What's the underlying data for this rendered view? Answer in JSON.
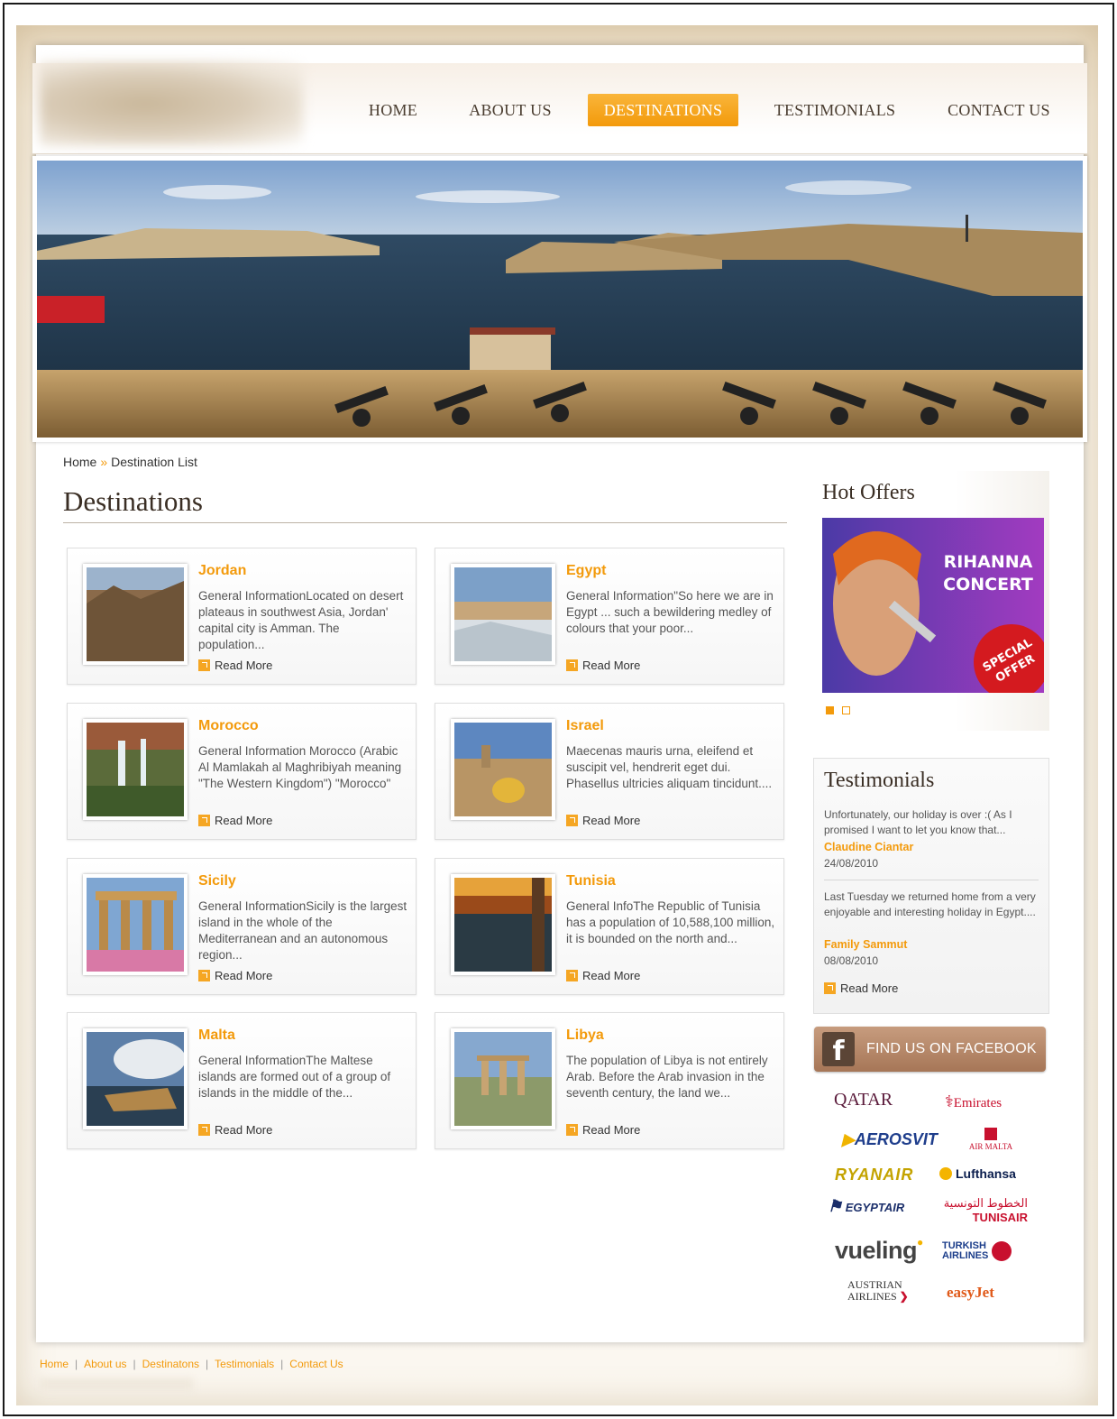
{
  "nav": {
    "home": "HOME",
    "about": "ABOUT US",
    "destinations": "DESTINATIONS",
    "testimonials": "TESTIMONIALS",
    "contact": "CONTACT US",
    "active": "DESTINATIONS"
  },
  "breadcrumb": {
    "home": "Home",
    "separator": "»",
    "current": "Destination List"
  },
  "page_title": "Destinations",
  "destinations": [
    {
      "name": "Jordan",
      "description": "General InformationLocated on desert plateaus in southwest Asia, Jordan' capital city is Amman. The population...",
      "read_more": "Read More"
    },
    {
      "name": "Egypt",
      "description": "General Information\"So here we are in Egypt ... such a bewildering medley of colours that your poor...",
      "read_more": "Read More"
    },
    {
      "name": "Morocco",
      "description": "General Information Morocco (Arabic Al Mamlakah al Maghribiyah meaning \"The Western Kingdom\") \"Morocco\"",
      "read_more": "Read More"
    },
    {
      "name": "Israel",
      "description": "Maecenas mauris urna, eleifend et suscipit vel, hendrerit eget dui. Phasellus ultricies aliquam tincidunt....",
      "read_more": "Read More"
    },
    {
      "name": "Sicily",
      "description": "General InformationSicily is the largest island in the whole of the Mediterranean and an autonomous region...",
      "read_more": "Read More"
    },
    {
      "name": "Tunisia",
      "description": "General InfoThe Republic of Tunisia has a population of 10,588,100 million, it is bounded on the north and...",
      "read_more": "Read More"
    },
    {
      "name": "Malta",
      "description": "General InformationThe Maltese islands are formed out of a group of islands in the middle of the...",
      "read_more": "Read More"
    },
    {
      "name": "Libya",
      "description": "The population of Libya is not entirely Arab. Before the Arab invasion in the seventh century, the land we...",
      "read_more": "Read More"
    }
  ],
  "hot_offers": {
    "title": "Hot Offers",
    "banner_line1": "RIHANNA",
    "banner_line2": "CONCERT",
    "badge_line1": "SPECIAL",
    "badge_line2": "OFFER"
  },
  "testimonials": {
    "title": "Testimonials",
    "items": [
      {
        "text": "Unfortunately, our holiday is over :( As I promised I want to let you know that...",
        "author": "Claudine Ciantar",
        "date": "24/08/2010"
      },
      {
        "text": "Last Tuesday we returned home from a very enjoyable and interesting holiday in Egypt....",
        "author": "Family Sammut",
        "date": "08/08/2010"
      }
    ],
    "read_more": "Read More"
  },
  "facebook": {
    "icon": "f",
    "label": "FIND US ON FACEBOOK"
  },
  "airlines": [
    "QATAR",
    "Emirates",
    "AEROSVIT",
    "AIR MALTA",
    "RYANAIR",
    "Lufthansa",
    "EGYPTAIR",
    "TUNISAIR",
    "vueling",
    "TURKISH AIRLINES",
    "AUSTRIAN AIRLINES",
    "easyJet"
  ],
  "airline_extra": {
    "tunisair_arabic": "الخطوط التونسية",
    "turkish_line1": "TURKISH",
    "turkish_line2": "AIRLINES",
    "austrian_line1": "AUSTRIAN",
    "austrian_line2": "AIRLINES"
  },
  "footer": {
    "links": [
      "Home",
      "About us",
      "Destinatons",
      "Testimonials",
      "Contact Us"
    ]
  },
  "colors": {
    "accent": "#f39a0b",
    "title": "#3a2e24",
    "facebook_button": "#b58466"
  }
}
